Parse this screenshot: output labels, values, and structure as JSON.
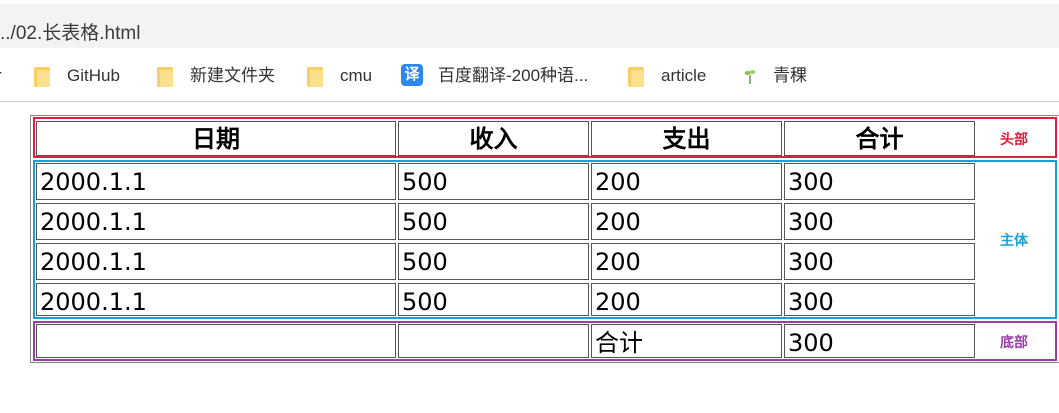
{
  "browser": {
    "address_text": "../02.长表格.html"
  },
  "bookmarks": {
    "partial_left": "r",
    "items": [
      {
        "label": "GitHub",
        "icon": "folder-icon"
      },
      {
        "label": "新建文件夹",
        "icon": "folder-icon"
      },
      {
        "label": "cmu",
        "icon": "folder-icon"
      },
      {
        "label": "百度翻译-200种语...",
        "icon": "translate-icon",
        "icon_text": "译"
      },
      {
        "label": "article",
        "icon": "folder-icon"
      },
      {
        "label": "青稞",
        "icon": "sprout-icon"
      }
    ]
  },
  "table": {
    "header": [
      "日期",
      "收入",
      "支出",
      "合计"
    ],
    "body": [
      [
        "2000.1.1",
        "500",
        "200",
        "300"
      ],
      [
        "2000.1.1",
        "500",
        "200",
        "300"
      ],
      [
        "2000.1.1",
        "500",
        "200",
        "300"
      ],
      [
        "2000.1.1",
        "500",
        "200",
        "300"
      ]
    ],
    "footer": [
      "",
      "",
      "合计",
      "300"
    ],
    "section_labels": {
      "head": "头部",
      "body": "主体",
      "foot": "底部"
    },
    "colors": {
      "head": "#e0203a",
      "body": "#1aa0d8",
      "foot": "#9b3fa6"
    }
  }
}
